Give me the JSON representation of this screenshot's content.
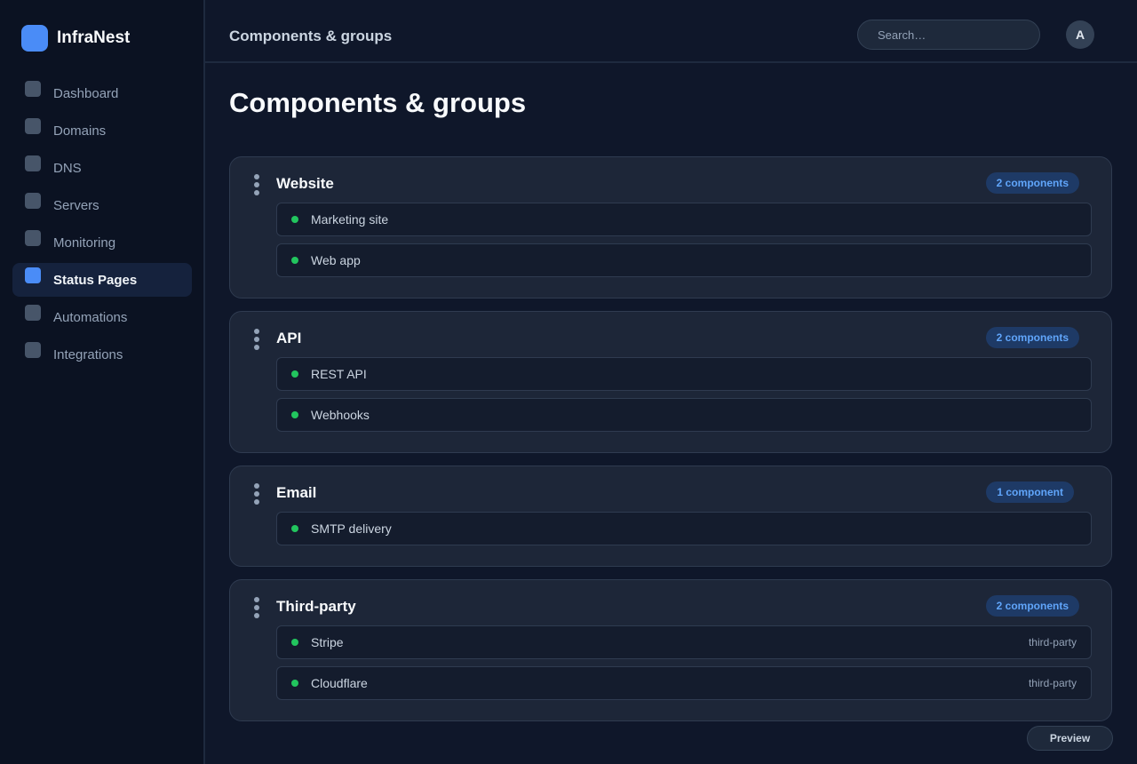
{
  "brand": {
    "name": "InfraNest"
  },
  "sidebar": {
    "items": [
      {
        "label": "Dashboard",
        "active": false
      },
      {
        "label": "Domains",
        "active": false
      },
      {
        "label": "DNS",
        "active": false
      },
      {
        "label": "Servers",
        "active": false
      },
      {
        "label": "Monitoring",
        "active": false
      },
      {
        "label": "Status Pages",
        "active": true
      },
      {
        "label": "Automations",
        "active": false
      },
      {
        "label": "Integrations",
        "active": false
      }
    ]
  },
  "header": {
    "title": "Components & groups",
    "search_placeholder": "Search…",
    "avatar_initial": "A"
  },
  "page": {
    "title": "Components & groups"
  },
  "groups": [
    {
      "name": "Website",
      "badge": "2 components",
      "components": [
        {
          "name": "Marketing site",
          "tag": "",
          "status": "operational"
        },
        {
          "name": "Web app",
          "tag": "",
          "status": "operational"
        }
      ]
    },
    {
      "name": "API",
      "badge": "2 components",
      "components": [
        {
          "name": "REST API",
          "tag": "",
          "status": "operational"
        },
        {
          "name": "Webhooks",
          "tag": "",
          "status": "operational"
        }
      ]
    },
    {
      "name": "Email",
      "badge": "1 component",
      "components": [
        {
          "name": "SMTP delivery",
          "tag": "",
          "status": "operational"
        }
      ]
    },
    {
      "name": "Third-party",
      "badge": "2 components",
      "components": [
        {
          "name": "Stripe",
          "tag": "third-party",
          "status": "operational"
        },
        {
          "name": "Cloudflare",
          "tag": "third-party",
          "status": "operational"
        }
      ]
    }
  ],
  "footer": {
    "preview_label": "Preview"
  },
  "colors": {
    "accent": "#4a8cf7",
    "status_operational": "#22c55e",
    "badge_text": "#60a5fa"
  }
}
